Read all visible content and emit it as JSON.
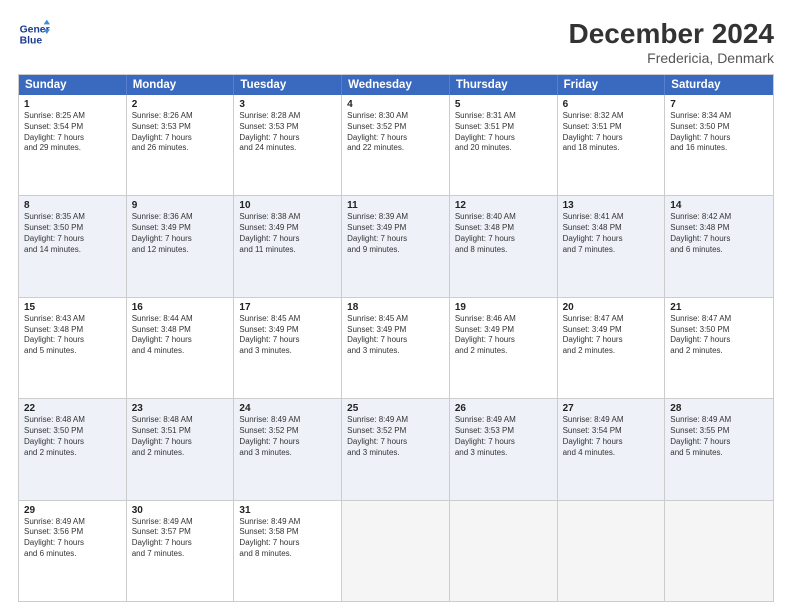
{
  "logo": {
    "line1": "General",
    "line2": "Blue"
  },
  "title": "December 2024",
  "subtitle": "Fredericia, Denmark",
  "header_days": [
    "Sunday",
    "Monday",
    "Tuesday",
    "Wednesday",
    "Thursday",
    "Friday",
    "Saturday"
  ],
  "rows": [
    {
      "alt": false,
      "cells": [
        {
          "day": "1",
          "lines": [
            "Sunrise: 8:25 AM",
            "Sunset: 3:54 PM",
            "Daylight: 7 hours",
            "and 29 minutes."
          ]
        },
        {
          "day": "2",
          "lines": [
            "Sunrise: 8:26 AM",
            "Sunset: 3:53 PM",
            "Daylight: 7 hours",
            "and 26 minutes."
          ]
        },
        {
          "day": "3",
          "lines": [
            "Sunrise: 8:28 AM",
            "Sunset: 3:53 PM",
            "Daylight: 7 hours",
            "and 24 minutes."
          ]
        },
        {
          "day": "4",
          "lines": [
            "Sunrise: 8:30 AM",
            "Sunset: 3:52 PM",
            "Daylight: 7 hours",
            "and 22 minutes."
          ]
        },
        {
          "day": "5",
          "lines": [
            "Sunrise: 8:31 AM",
            "Sunset: 3:51 PM",
            "Daylight: 7 hours",
            "and 20 minutes."
          ]
        },
        {
          "day": "6",
          "lines": [
            "Sunrise: 8:32 AM",
            "Sunset: 3:51 PM",
            "Daylight: 7 hours",
            "and 18 minutes."
          ]
        },
        {
          "day": "7",
          "lines": [
            "Sunrise: 8:34 AM",
            "Sunset: 3:50 PM",
            "Daylight: 7 hours",
            "and 16 minutes."
          ]
        }
      ]
    },
    {
      "alt": true,
      "cells": [
        {
          "day": "8",
          "lines": [
            "Sunrise: 8:35 AM",
            "Sunset: 3:50 PM",
            "Daylight: 7 hours",
            "and 14 minutes."
          ]
        },
        {
          "day": "9",
          "lines": [
            "Sunrise: 8:36 AM",
            "Sunset: 3:49 PM",
            "Daylight: 7 hours",
            "and 12 minutes."
          ]
        },
        {
          "day": "10",
          "lines": [
            "Sunrise: 8:38 AM",
            "Sunset: 3:49 PM",
            "Daylight: 7 hours",
            "and 11 minutes."
          ]
        },
        {
          "day": "11",
          "lines": [
            "Sunrise: 8:39 AM",
            "Sunset: 3:49 PM",
            "Daylight: 7 hours",
            "and 9 minutes."
          ]
        },
        {
          "day": "12",
          "lines": [
            "Sunrise: 8:40 AM",
            "Sunset: 3:48 PM",
            "Daylight: 7 hours",
            "and 8 minutes."
          ]
        },
        {
          "day": "13",
          "lines": [
            "Sunrise: 8:41 AM",
            "Sunset: 3:48 PM",
            "Daylight: 7 hours",
            "and 7 minutes."
          ]
        },
        {
          "day": "14",
          "lines": [
            "Sunrise: 8:42 AM",
            "Sunset: 3:48 PM",
            "Daylight: 7 hours",
            "and 6 minutes."
          ]
        }
      ]
    },
    {
      "alt": false,
      "cells": [
        {
          "day": "15",
          "lines": [
            "Sunrise: 8:43 AM",
            "Sunset: 3:48 PM",
            "Daylight: 7 hours",
            "and 5 minutes."
          ]
        },
        {
          "day": "16",
          "lines": [
            "Sunrise: 8:44 AM",
            "Sunset: 3:48 PM",
            "Daylight: 7 hours",
            "and 4 minutes."
          ]
        },
        {
          "day": "17",
          "lines": [
            "Sunrise: 8:45 AM",
            "Sunset: 3:49 PM",
            "Daylight: 7 hours",
            "and 3 minutes."
          ]
        },
        {
          "day": "18",
          "lines": [
            "Sunrise: 8:45 AM",
            "Sunset: 3:49 PM",
            "Daylight: 7 hours",
            "and 3 minutes."
          ]
        },
        {
          "day": "19",
          "lines": [
            "Sunrise: 8:46 AM",
            "Sunset: 3:49 PM",
            "Daylight: 7 hours",
            "and 2 minutes."
          ]
        },
        {
          "day": "20",
          "lines": [
            "Sunrise: 8:47 AM",
            "Sunset: 3:49 PM",
            "Daylight: 7 hours",
            "and 2 minutes."
          ]
        },
        {
          "day": "21",
          "lines": [
            "Sunrise: 8:47 AM",
            "Sunset: 3:50 PM",
            "Daylight: 7 hours",
            "and 2 minutes."
          ]
        }
      ]
    },
    {
      "alt": true,
      "cells": [
        {
          "day": "22",
          "lines": [
            "Sunrise: 8:48 AM",
            "Sunset: 3:50 PM",
            "Daylight: 7 hours",
            "and 2 minutes."
          ]
        },
        {
          "day": "23",
          "lines": [
            "Sunrise: 8:48 AM",
            "Sunset: 3:51 PM",
            "Daylight: 7 hours",
            "and 2 minutes."
          ]
        },
        {
          "day": "24",
          "lines": [
            "Sunrise: 8:49 AM",
            "Sunset: 3:52 PM",
            "Daylight: 7 hours",
            "and 3 minutes."
          ]
        },
        {
          "day": "25",
          "lines": [
            "Sunrise: 8:49 AM",
            "Sunset: 3:52 PM",
            "Daylight: 7 hours",
            "and 3 minutes."
          ]
        },
        {
          "day": "26",
          "lines": [
            "Sunrise: 8:49 AM",
            "Sunset: 3:53 PM",
            "Daylight: 7 hours",
            "and 3 minutes."
          ]
        },
        {
          "day": "27",
          "lines": [
            "Sunrise: 8:49 AM",
            "Sunset: 3:54 PM",
            "Daylight: 7 hours",
            "and 4 minutes."
          ]
        },
        {
          "day": "28",
          "lines": [
            "Sunrise: 8:49 AM",
            "Sunset: 3:55 PM",
            "Daylight: 7 hours",
            "and 5 minutes."
          ]
        }
      ]
    },
    {
      "alt": false,
      "cells": [
        {
          "day": "29",
          "lines": [
            "Sunrise: 8:49 AM",
            "Sunset: 3:56 PM",
            "Daylight: 7 hours",
            "and 6 minutes."
          ]
        },
        {
          "day": "30",
          "lines": [
            "Sunrise: 8:49 AM",
            "Sunset: 3:57 PM",
            "Daylight: 7 hours",
            "and 7 minutes."
          ]
        },
        {
          "day": "31",
          "lines": [
            "Sunrise: 8:49 AM",
            "Sunset: 3:58 PM",
            "Daylight: 7 hours",
            "and 8 minutes."
          ]
        },
        {
          "day": "",
          "lines": []
        },
        {
          "day": "",
          "lines": []
        },
        {
          "day": "",
          "lines": []
        },
        {
          "day": "",
          "lines": []
        }
      ]
    }
  ]
}
